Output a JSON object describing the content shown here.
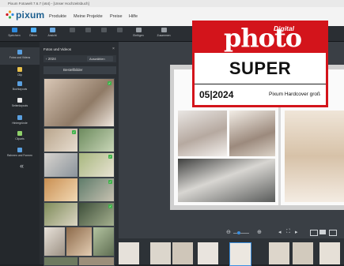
{
  "window": {
    "title": "Pixum Fotowelt 7.6.7 (x64) - [Unser Hochzeitsbuch]"
  },
  "app": {
    "logo_text": "pixum",
    "brand_color": "#1d5f8f"
  },
  "menu": [
    {
      "label": "Produkte"
    },
    {
      "label": "Meine Projekte"
    },
    {
      "label": "Preise"
    },
    {
      "label": "Hilfe"
    }
  ],
  "toolbar": [
    {
      "label": "Speichern",
      "icon": "save-icon",
      "color": "#2e8be0"
    },
    {
      "label": "Öffnen",
      "icon": "folder-icon",
      "color": "#4fb1ff"
    },
    {
      "label": "Ansicht",
      "icon": "person-icon",
      "color": "#6aa8e0"
    },
    {
      "label": "Einfügen",
      "icon": "paste-icon",
      "color": "#9aa0a6"
    },
    {
      "label": "Zusammen",
      "icon": "group-icon",
      "color": "#9aa0a6"
    }
  ],
  "sidebar": [
    {
      "label": "Fotos und Videos",
      "icon": "photos-icon"
    },
    {
      "label": "Clip",
      "icon": "clip-icon"
    },
    {
      "label": "Buchlayouts",
      "icon": "layout-icon"
    },
    {
      "label": "Seitenlayouts",
      "icon": "page-layout-icon"
    },
    {
      "label": "Hintergründe",
      "icon": "background-icon"
    },
    {
      "label": "Cliparts",
      "icon": "clipart-icon"
    },
    {
      "label": "Rahmen und Formen",
      "icon": "frame-icon"
    }
  ],
  "sidebar_collapse": "«",
  "photo_panel": {
    "title": "Fotos und Videos",
    "close": "×",
    "back_label": "‹ 2024",
    "select_label": "Auswählen",
    "used_label": "Bestellbilder"
  },
  "badge": {
    "digital": "Digital",
    "photo": "photo",
    "rating": "SUPER",
    "date": "05|2024",
    "product": "Pixum Hardcover groß",
    "color": "#d3141b"
  }
}
